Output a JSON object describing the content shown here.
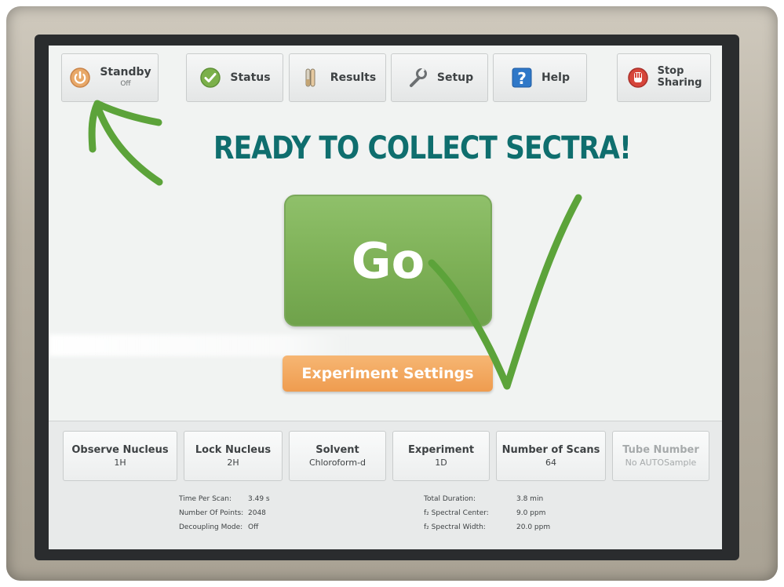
{
  "toolbar": {
    "standby": {
      "label": "Standby",
      "sub": "Off"
    },
    "status": {
      "label": "Status"
    },
    "results": {
      "label": "Results"
    },
    "setup": {
      "label": "Setup"
    },
    "help": {
      "label": "Help"
    },
    "stop_sharing": {
      "line1": "Stop",
      "line2": "Sharing"
    }
  },
  "headline": "READY TO COLLECT SECTRA!",
  "go_label": "Go",
  "experiment_settings_label": "Experiment Settings",
  "params": [
    {
      "label": "Observe Nucleus",
      "value": "1H"
    },
    {
      "label": "Lock Nucleus",
      "value": "2H"
    },
    {
      "label": "Solvent",
      "value": "Chloroform-d"
    },
    {
      "label": "Experiment",
      "value": "1D"
    },
    {
      "label": "Number of Scans",
      "value": "64"
    },
    {
      "label": "Tube Number",
      "value": "No AUTOSample"
    }
  ],
  "info_left": [
    {
      "k": "Time Per Scan:",
      "v": "3.49 s"
    },
    {
      "k": "Number Of Points:",
      "v": "2048"
    },
    {
      "k": "Decoupling Mode:",
      "v": "Off"
    }
  ],
  "info_right": [
    {
      "k": "Total Duration:",
      "v": "3.8 min"
    },
    {
      "k": "f₂ Spectral Center:",
      "v": "9.0 ppm"
    },
    {
      "k": "f₂ Spectral Width:",
      "v": "20.0 ppm"
    }
  ],
  "colors": {
    "headline": "#0f6e6e",
    "go_button": "#7db056",
    "settings_button": "#ef9c4f",
    "annotation": "#5ca33a"
  },
  "icons": [
    "power-icon",
    "checkmark-icon",
    "test-tubes-icon",
    "wrench-icon",
    "question-icon",
    "stop-hand-icon"
  ]
}
